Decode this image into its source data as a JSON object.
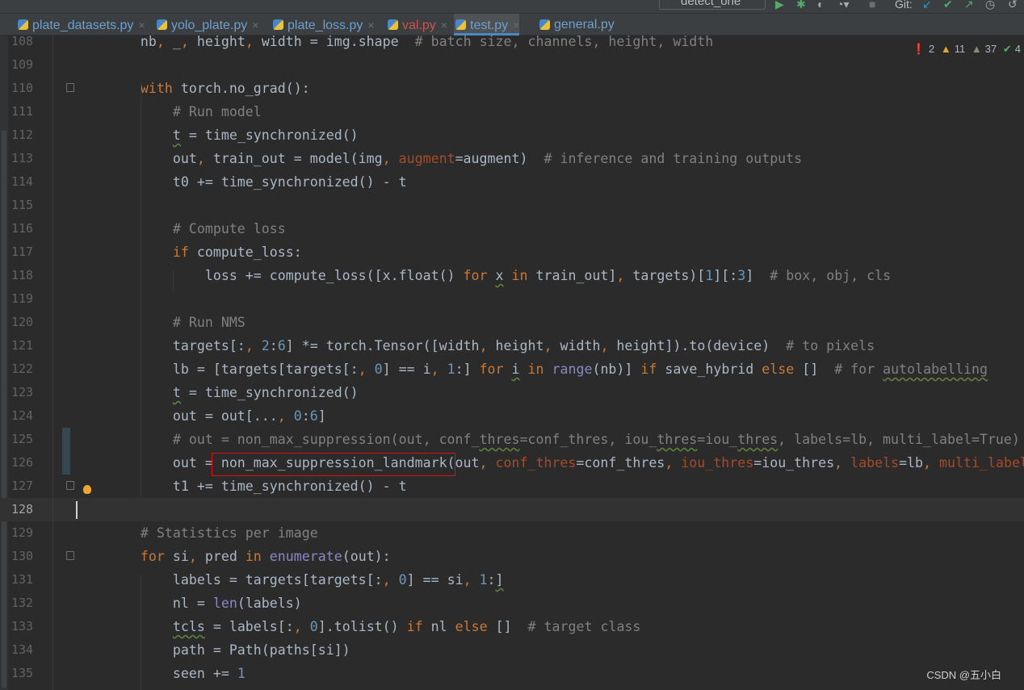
{
  "toolbar": {
    "run_config": "detect_one",
    "git_label": "Git:"
  },
  "tabs": [
    {
      "label": "plate_datasets.py",
      "color": "#6c9fd0"
    },
    {
      "label": "yolo_plate.py",
      "color": "#6c9fd0"
    },
    {
      "label": "plate_loss.py",
      "color": "#6c9fd0"
    },
    {
      "label": "val.py",
      "color": "#c75450"
    },
    {
      "label": "test.py",
      "color": "#6c9fd0",
      "active": true
    },
    {
      "label": "general.py",
      "color": "#6c9fd0"
    }
  ],
  "inspections": {
    "errors": "2",
    "warnings": "11",
    "weak_warnings": "37",
    "ok": "4"
  },
  "watermark": "CSDN @五小白",
  "current_line": 128,
  "lines": [
    {
      "n": "108",
      "t": [
        [
          "",
          "        nb"
        ],
        [
          "k",
          ", "
        ],
        [
          "",
          "_"
        ],
        [
          "k",
          ", "
        ],
        [
          "",
          "height"
        ],
        [
          "k",
          ", "
        ],
        [
          "",
          "width = img.shape  "
        ],
        [
          "c",
          "# batch size, channels, height, width"
        ]
      ]
    },
    {
      "n": "109",
      "t": []
    },
    {
      "n": "110",
      "t": [
        [
          "k",
          "        with "
        ],
        [
          "",
          "torch.no_grad():"
        ]
      ]
    },
    {
      "n": "111",
      "t": [
        [
          "c",
          "            # Run model"
        ]
      ]
    },
    {
      "n": "112",
      "t": [
        [
          "",
          "            "
        ],
        [
          "w",
          "t"
        ],
        [
          "",
          " = time_synchronized()"
        ]
      ]
    },
    {
      "n": "113",
      "t": [
        [
          "",
          "            out"
        ],
        [
          "k",
          ", "
        ],
        [
          "",
          "train_out = model(img"
        ],
        [
          "k",
          ", "
        ],
        [
          "p",
          "augment"
        ],
        [
          "",
          "=augment)  "
        ],
        [
          "c",
          "# inference and training outputs"
        ]
      ]
    },
    {
      "n": "114",
      "t": [
        [
          "",
          "            t0 += time_synchronized() - t"
        ]
      ]
    },
    {
      "n": "115",
      "t": []
    },
    {
      "n": "116",
      "t": [
        [
          "c",
          "            # Compute loss"
        ]
      ]
    },
    {
      "n": "117",
      "t": [
        [
          "k",
          "            if "
        ],
        [
          "",
          "compute_loss:"
        ]
      ]
    },
    {
      "n": "118",
      "t": [
        [
          "",
          "                loss += compute_loss([x.float() "
        ],
        [
          "k",
          "for "
        ],
        [
          "w",
          "x"
        ],
        [
          "k",
          " in "
        ],
        [
          "",
          "train_out]"
        ],
        [
          "k",
          ", "
        ],
        [
          "",
          "targets)["
        ],
        [
          "n",
          "1"
        ],
        [
          "",
          "][:"
        ],
        [
          "n",
          "3"
        ],
        [
          "",
          "]  "
        ],
        [
          "c",
          "# box, obj, cls"
        ]
      ]
    },
    {
      "n": "119",
      "t": []
    },
    {
      "n": "120",
      "t": [
        [
          "c",
          "            # Run NMS"
        ]
      ]
    },
    {
      "n": "121",
      "t": [
        [
          "",
          "            targets[:"
        ],
        [
          "k",
          ", "
        ],
        [
          "n",
          "2"
        ],
        [
          "",
          ":"
        ],
        [
          "n",
          "6"
        ],
        [
          "",
          "] *= torch.Tensor([width"
        ],
        [
          "k",
          ", "
        ],
        [
          "",
          "height"
        ],
        [
          "k",
          ", "
        ],
        [
          "",
          "width"
        ],
        [
          "k",
          ", "
        ],
        [
          "",
          "height]).to(device)  "
        ],
        [
          "c",
          "# to pixels"
        ]
      ]
    },
    {
      "n": "122",
      "t": [
        [
          "",
          "            lb = [targets[targets[:"
        ],
        [
          "k",
          ", "
        ],
        [
          "n",
          "0"
        ],
        [
          "",
          "] == i"
        ],
        [
          "k",
          ", "
        ],
        [
          "n",
          "1"
        ],
        [
          ":",
          ":]"
        ],
        [
          "k",
          " for "
        ],
        [
          "w",
          "i"
        ],
        [
          "k",
          " in "
        ],
        [
          "b",
          "range"
        ],
        [
          "",
          "(nb)] "
        ],
        [
          "k",
          "if "
        ],
        [
          "",
          "save_hybrid "
        ],
        [
          "k",
          "else "
        ],
        [
          "",
          "[]  "
        ],
        [
          "c",
          "# for "
        ],
        [
          "c w",
          "autolabelling"
        ]
      ]
    },
    {
      "n": "123",
      "t": [
        [
          "",
          "            "
        ],
        [
          "w",
          "t"
        ],
        [
          "",
          " = time_synchronized()"
        ]
      ]
    },
    {
      "n": "124",
      "t": [
        [
          "",
          "            out = out[..."
        ],
        [
          "k",
          ", "
        ],
        [
          "n",
          "0"
        ],
        [
          "",
          ":"
        ],
        [
          "n",
          "6"
        ],
        [
          "",
          "]"
        ]
      ]
    },
    {
      "n": "125",
      "t": [
        [
          "c",
          "            # out = non_max_suppression(out, conf_"
        ],
        [
          "c w",
          "thres"
        ],
        [
          "c",
          "=conf_thres, iou_"
        ],
        [
          "c w",
          "thres"
        ],
        [
          "c",
          "=iou_"
        ],
        [
          "c w",
          "thres"
        ],
        [
          "c",
          ", labels=lb, multi_label=True)"
        ]
      ]
    },
    {
      "n": "126",
      "t": [
        [
          "",
          "            out = non_max_suppression_landmark(out"
        ],
        [
          "k",
          ", "
        ],
        [
          "p",
          "conf_thres"
        ],
        [
          "",
          "=conf_thres"
        ],
        [
          "k",
          ", "
        ],
        [
          "p",
          "iou_thres"
        ],
        [
          "",
          "=iou_thres"
        ],
        [
          "k",
          ", "
        ],
        [
          "p",
          "labels"
        ],
        [
          "",
          "=lb"
        ],
        [
          "k",
          ", "
        ],
        [
          "p",
          "multi_label"
        ]
      ]
    },
    {
      "n": "127",
      "t": [
        [
          "",
          "            t1 += time_synchronized() - t"
        ]
      ]
    },
    {
      "n": "128",
      "t": []
    },
    {
      "n": "129",
      "t": [
        [
          "c",
          "        # Statistics per image"
        ]
      ]
    },
    {
      "n": "130",
      "t": [
        [
          "k",
          "        for "
        ],
        [
          "",
          "si"
        ],
        [
          "k",
          ", "
        ],
        [
          "",
          "pred "
        ],
        [
          "k",
          "in "
        ],
        [
          "b",
          "enumerate"
        ],
        [
          "",
          "(out):"
        ]
      ]
    },
    {
      "n": "131",
      "t": [
        [
          "",
          "            labels = targets[targets[:"
        ],
        [
          "k",
          ", "
        ],
        [
          "n",
          "0"
        ],
        [
          "",
          "] == si"
        ],
        [
          "k",
          ", "
        ],
        [
          "n",
          "1"
        ],
        [
          "",
          ":"
        ],
        [
          "w",
          "]"
        ]
      ]
    },
    {
      "n": "132",
      "t": [
        [
          "",
          "            nl = "
        ],
        [
          "b",
          "len"
        ],
        [
          "",
          "(labels)"
        ]
      ]
    },
    {
      "n": "133",
      "t": [
        [
          "",
          "            "
        ],
        [
          "w",
          "tcls"
        ],
        [
          "",
          " = labels[:"
        ],
        [
          "k",
          ", "
        ],
        [
          "n",
          "0"
        ],
        [
          "",
          "].tolist() "
        ],
        [
          "k",
          "if "
        ],
        [
          "",
          "nl "
        ],
        [
          "k",
          "else "
        ],
        [
          "",
          "[]  "
        ],
        [
          "c",
          "# target class"
        ]
      ]
    },
    {
      "n": "134",
      "t": [
        [
          "",
          "            path = Path(paths[si])"
        ]
      ]
    },
    {
      "n": "135",
      "t": [
        [
          "",
          "            seen += "
        ],
        [
          "n",
          "1"
        ]
      ]
    }
  ]
}
